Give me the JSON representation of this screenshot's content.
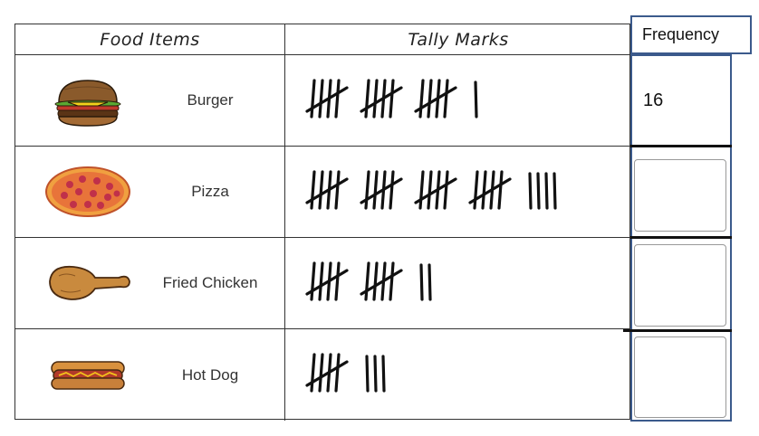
{
  "headers": {
    "food_items": "Food Items",
    "tally_marks": "Tally Marks",
    "frequency": "Frequency"
  },
  "rows": [
    {
      "food": "Burger",
      "icon": "burger-icon",
      "tally_count": 16,
      "frequency": "16"
    },
    {
      "food": "Pizza",
      "icon": "pizza-icon",
      "tally_count": 24,
      "frequency": ""
    },
    {
      "food": "Fried Chicken",
      "icon": "fried-chicken-icon",
      "tally_count": 12,
      "frequency": ""
    },
    {
      "food": "Hot Dog",
      "icon": "hot-dog-icon",
      "tally_count": 8,
      "frequency": ""
    }
  ],
  "colors": {
    "frequency_border": "#3b5a8c",
    "table_border": "#333333"
  }
}
